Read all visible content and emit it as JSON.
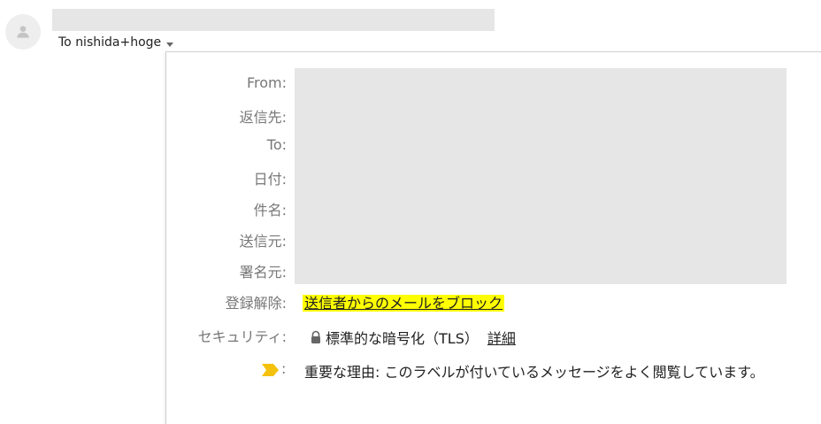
{
  "header": {
    "to_text": "To nishida+hoge"
  },
  "details": {
    "from_label": "From:",
    "reply_to_label": "返信先:",
    "to_label": "To:",
    "date_label": "日付:",
    "subject_label": "件名:",
    "mailed_by_label": "送信元:",
    "signed_by_label": "署名元:",
    "unsubscribe_label": "登録解除:",
    "unsubscribe_link": "送信者からのメールをブロック",
    "security_label": "セキュリティ:",
    "security_value": "標準的な暗号化（TLS）",
    "security_details_link": "詳細",
    "importance_colon": ":",
    "importance_text": "重要な理由: このラベルが付いているメッセージをよく閲覧しています。"
  },
  "icons": {
    "avatar": "person-icon",
    "dropdown": "caret-down-icon",
    "lock": "lock-icon",
    "importance": "importance-marker-icon"
  },
  "colors": {
    "highlight": "#ffff00",
    "importance": "#f4c20d",
    "redaction": "#e6e6e6"
  }
}
